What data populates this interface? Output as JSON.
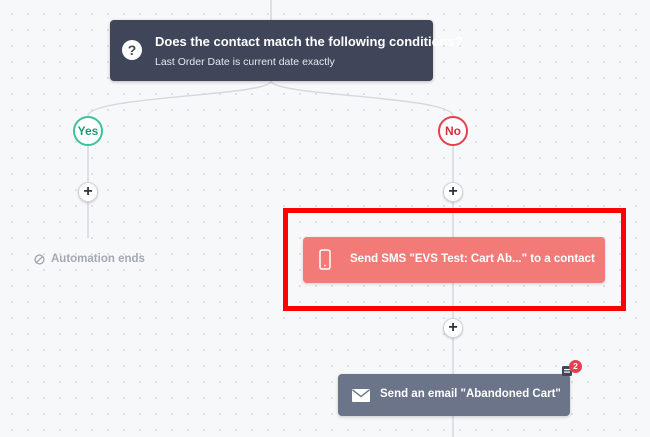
{
  "condition": {
    "title": "Does the contact match the following conditions?",
    "subtitle": "Last Order Date is current date exactly",
    "icon": "question-icon",
    "icon_glyph": "?"
  },
  "branches": {
    "yes_label": "Yes",
    "no_label": "No",
    "yes_color": "#3fc29a",
    "no_color": "#e5404f"
  },
  "add_step_label": "+",
  "automation_end": {
    "label": "Automation ends",
    "icon": "ban-icon"
  },
  "sms_action": {
    "label": "Send SMS \"EVS Test: Cart Ab...\" to a contact",
    "icon": "phone-icon",
    "color": "#f27b78"
  },
  "email_action": {
    "label": "Send an email \"Abandoned Cart\"",
    "icon": "envelope-icon",
    "color": "#6b7489",
    "notification_count": "2"
  },
  "highlight_color": "#ff0000"
}
